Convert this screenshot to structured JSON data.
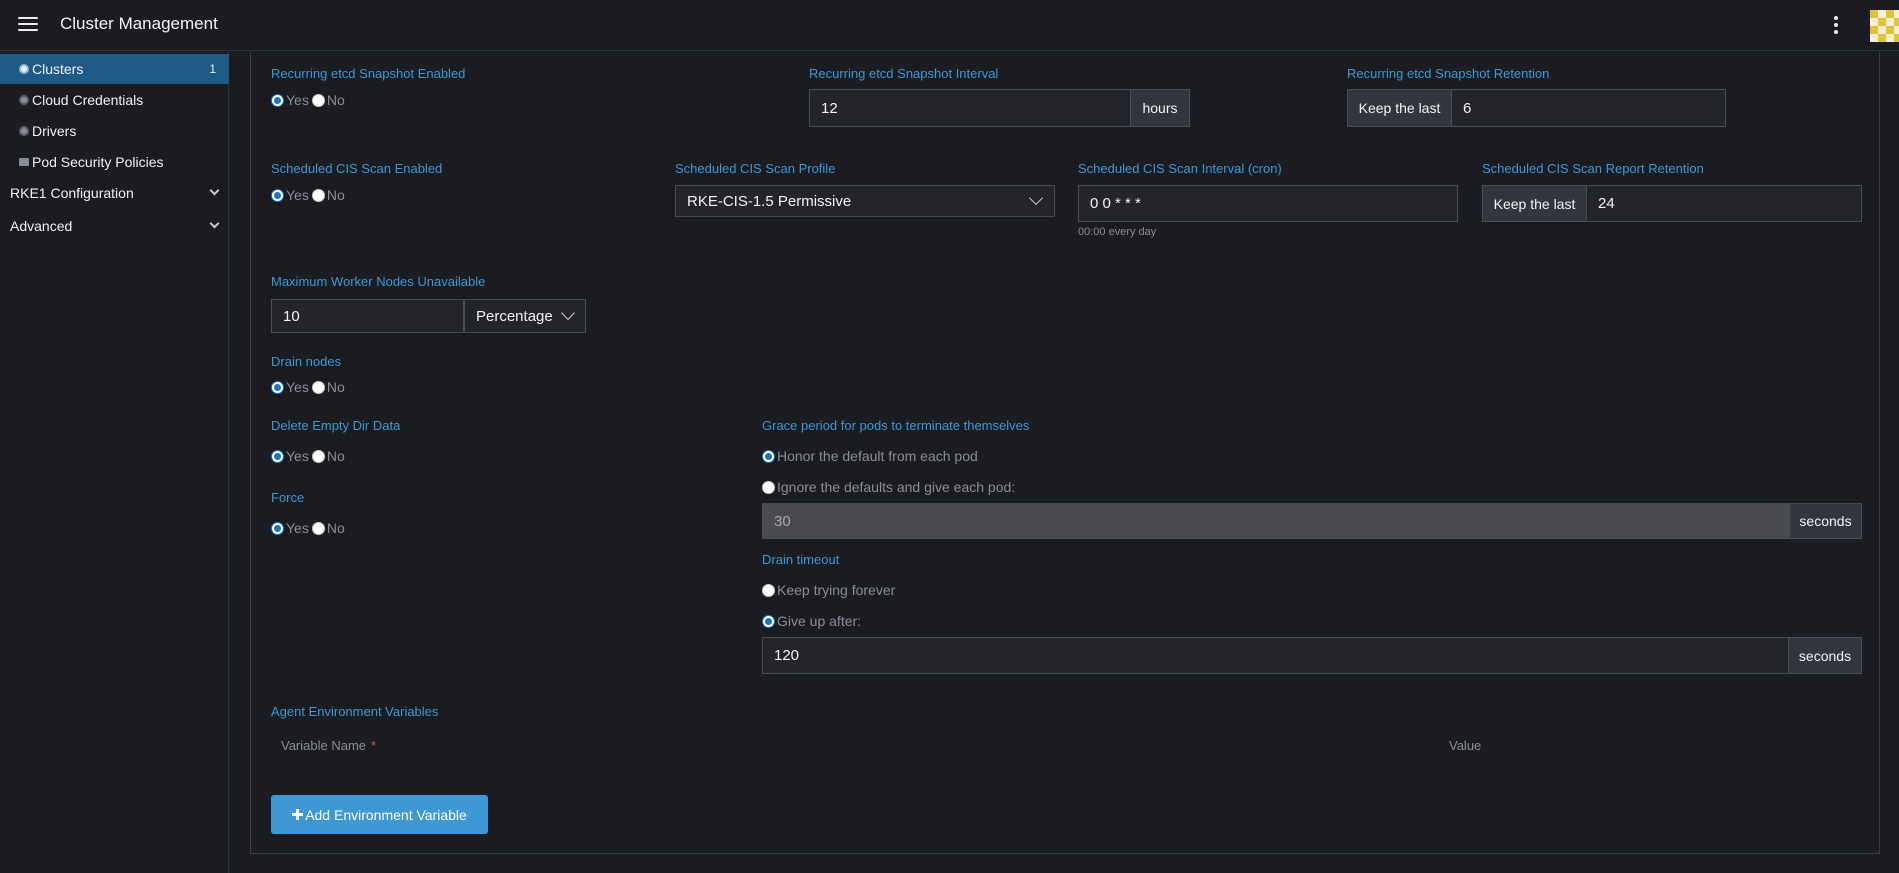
{
  "header": {
    "title": "Cluster Management"
  },
  "sidebar": {
    "items": [
      {
        "label": "Clusters",
        "count": "1",
        "icon": "gear-icon"
      },
      {
        "label": "Cloud Credentials",
        "icon": "gear-icon"
      },
      {
        "label": "Drivers",
        "icon": "gear-icon"
      },
      {
        "label": "Pod Security Policies",
        "icon": "folder-icon"
      }
    ],
    "groups": [
      {
        "label": "RKE1 Configuration"
      },
      {
        "label": "Advanced"
      }
    ]
  },
  "radio": {
    "yes": "Yes",
    "no": "No"
  },
  "etcd": {
    "enabled_label": "Recurring etcd Snapshot Enabled",
    "interval_label": "Recurring etcd Snapshot Interval",
    "interval_value": "12",
    "interval_unit": "hours",
    "retention_label": "Recurring etcd Snapshot Retention",
    "retention_prefix": "Keep the last",
    "retention_value": "6"
  },
  "cis": {
    "enabled_label": "Scheduled CIS Scan Enabled",
    "profile_label": "Scheduled CIS Scan Profile",
    "profile_value": "RKE-CIS-1.5 Permissive",
    "interval_label": "Scheduled CIS Scan Interval (cron)",
    "interval_value": "0 0 * * *",
    "interval_hint": "00:00 every day",
    "retention_label": "Scheduled CIS Scan Report Retention",
    "retention_prefix": "Keep the last",
    "retention_value": "24"
  },
  "max_unavailable": {
    "label": "Maximum Worker Nodes Unavailable",
    "value": "10",
    "unit": "Percentage"
  },
  "drain": {
    "label": "Drain nodes",
    "delete_label": "Delete Empty Dir Data",
    "force_label": "Force",
    "grace_label": "Grace period for pods to terminate themselves",
    "grace_option_default": "Honor the default from each pod",
    "grace_option_custom": "Ignore the defaults and give each pod:",
    "grace_value": "30",
    "grace_unit": "seconds",
    "timeout_label": "Drain timeout",
    "timeout_option_forever": "Keep trying forever",
    "timeout_option_giveup": "Give up after:",
    "timeout_value": "120",
    "timeout_unit": "seconds"
  },
  "env": {
    "label": "Agent Environment Variables",
    "col_name": "Variable Name",
    "required_mark": "*",
    "col_value": "Value",
    "add_button": "Add Environment Variable"
  },
  "colors": {
    "accent": "#3d98d3",
    "active_nav": "#1e5a86",
    "background": "#1b1c21"
  }
}
